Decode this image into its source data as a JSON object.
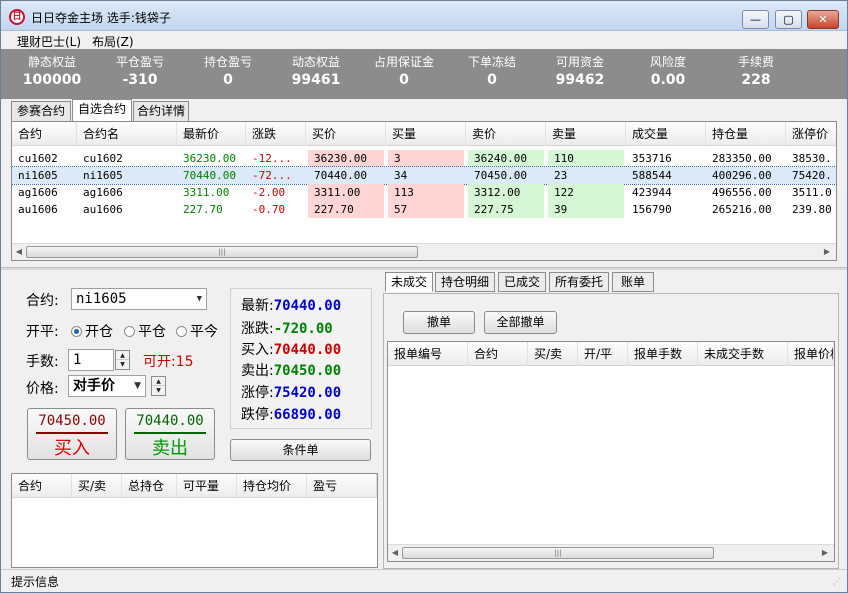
{
  "window": {
    "title": "日日夺金主场  选手:钱袋子",
    "icon_glyph": "日",
    "min_glyph": "—",
    "max_glyph": "▢",
    "close_glyph": "✕"
  },
  "menu": [
    "理财巴士(L)",
    "布局(Z)"
  ],
  "summary": [
    {
      "label": "静态权益",
      "value": "100000"
    },
    {
      "label": "平仓盈亏",
      "value": "-310"
    },
    {
      "label": "持仓盈亏",
      "value": "0"
    },
    {
      "label": "动态权益",
      "value": "99461"
    },
    {
      "label": "占用保证金",
      "value": "0"
    },
    {
      "label": "下单冻结",
      "value": "0"
    },
    {
      "label": "可用资金",
      "value": "99462"
    },
    {
      "label": "风险度",
      "value": "0.00"
    },
    {
      "label": "手续费",
      "value": "228"
    }
  ],
  "top_tabs": [
    "参赛合约",
    "自选合约",
    "合约详情"
  ],
  "quote_table": {
    "columns": [
      "合约",
      "合约名",
      "最新价",
      "涨跌",
      "买价",
      "买量",
      "卖价",
      "卖量",
      "成交量",
      "持仓量",
      "涨停价"
    ],
    "rows": [
      [
        "cu1602",
        "cu1602",
        "36230.00",
        "-12...",
        "36230.00",
        "3",
        "36240.00",
        "110",
        "353716",
        "283350.00",
        "38530."
      ],
      [
        "ni1605",
        "ni1605",
        "70440.00",
        "-72...",
        "70440.00",
        "34",
        "70450.00",
        "23",
        "588544",
        "400296.00",
        "75420."
      ],
      [
        "ag1606",
        "ag1606",
        "3311.00",
        "-2.00",
        "3311.00",
        "113",
        "3312.00",
        "122",
        "423944",
        "496556.00",
        "3511.0"
      ],
      [
        "au1606",
        "au1606",
        "227.70",
        "-0.70",
        "227.70",
        "57",
        "227.75",
        "39",
        "156790",
        "265216.00",
        "239.80"
      ]
    ],
    "selected_row": 1
  },
  "order": {
    "contract_label": "合约:",
    "contract_value": "ni1605",
    "offset_label": "开平:",
    "offset_options": [
      "开仓",
      "平仓",
      "平今"
    ],
    "offset_selected": 0,
    "qty_label": "手数:",
    "qty_value": "1",
    "can_open": "可开:15",
    "price_label": "价格:",
    "price_value": "对手价",
    "buy_price": "70450.00",
    "buy_label": "买入",
    "sell_price": "70440.00",
    "sell_label": "卖出"
  },
  "quote": [
    {
      "label": "最新:",
      "value": "70440.00",
      "color": "#0000cc"
    },
    {
      "label": "涨跌:",
      "value": "-720.00",
      "color": "#008000"
    },
    {
      "label": "买入:",
      "value": "70440.00",
      "color": "#cc0000"
    },
    {
      "label": "卖出:",
      "value": "70450.00",
      "color": "#008000"
    },
    {
      "label": "涨停:",
      "value": "75420.00",
      "color": "#0000cc"
    },
    {
      "label": "跌停:",
      "value": "66890.00",
      "color": "#0000cc"
    }
  ],
  "condition_button": "条件单",
  "position_table": {
    "columns": [
      "合约",
      "买/卖",
      "总持仓",
      "可平量",
      "持仓均价",
      "盈亏"
    ]
  },
  "right_tabs": [
    "未成交",
    "持仓明细",
    "已成交",
    "所有委托",
    "账单"
  ],
  "cancel_button": "撤单",
  "cancel_all_button": "全部撤单",
  "pending_table": {
    "columns": [
      "报单编号",
      "合约",
      "买/卖",
      "开/平",
      "报单手数",
      "未成交手数",
      "报单价格"
    ]
  },
  "status": "提示信息",
  "colors": {
    "up_red": "#cc0000",
    "down_green": "#008000",
    "quote_blue": "#0000cc",
    "bid_bg": "#ffd5d5",
    "ask_bg": "#d5f7d5",
    "summary_bg": "#8c8c8c"
  }
}
